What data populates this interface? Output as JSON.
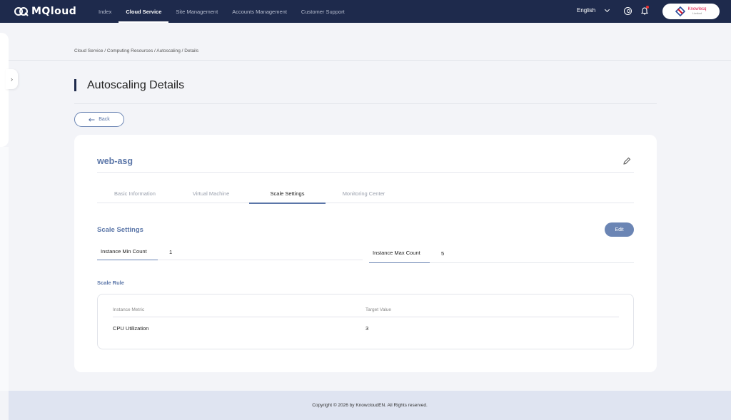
{
  "brand": {
    "logo_text": "MQloud",
    "partner_name": "Knowlecq",
    "partner_sub": "Limited"
  },
  "nav": {
    "items": [
      {
        "label": "Index",
        "active": false
      },
      {
        "label": "Cloud Service",
        "active": true
      },
      {
        "label": "Site Management",
        "active": false
      },
      {
        "label": "Accounts Management",
        "active": false
      },
      {
        "label": "Customer Support",
        "active": false
      }
    ],
    "language": "English"
  },
  "icons": {
    "rail_toggle": "chevron-right-icon",
    "back": "arrow-left-icon",
    "edit": "pencil-icon"
  },
  "breadcrumb": "Cloud Service / Computing Resources / Autoscaling / Details",
  "page_title": "Autoscaling Details",
  "back_label": "Back",
  "asg": {
    "name": "web-asg"
  },
  "tabs": [
    {
      "label": "Basic Information",
      "active": false
    },
    {
      "label": "Virtual Machine",
      "active": false
    },
    {
      "label": "Scale Settings",
      "active": true
    },
    {
      "label": "Monitoring Center",
      "active": false
    }
  ],
  "scale_settings": {
    "title": "Scale Settings",
    "edit_label": "Edit",
    "min_label": "Instance Min Count",
    "min_value": "1",
    "max_label": "Instance Max Count",
    "max_value": "5"
  },
  "scale_rule": {
    "title": "Scale Rule",
    "headers": [
      "Instance Metric",
      "Target Value"
    ],
    "rows": [
      [
        "CPU Utilization",
        "3"
      ]
    ]
  },
  "footer": "Copyright © 2026 by KnowcloudEN. All Rights reserved.",
  "colors": {
    "topbar": "#1e2a4c",
    "accent": "#5b76a8",
    "button": "#6b85b4"
  }
}
